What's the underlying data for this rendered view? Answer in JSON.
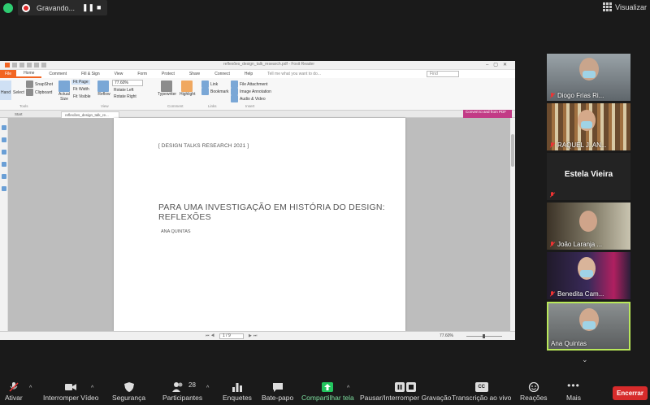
{
  "recording": {
    "label": "Gravando..."
  },
  "view": {
    "label": "Visualizar"
  },
  "reader": {
    "window_title": "reflexões_design_talk_research.pdf - Foxit Reader",
    "menu": [
      "File",
      "Home",
      "Comment",
      "Fill & Sign",
      "View",
      "Form",
      "Protect",
      "Share",
      "Connect",
      "Help"
    ],
    "tell_me": "Tell me what you want to do...",
    "find_placeholder": "Find",
    "ribbon": {
      "hand": "Hand",
      "select": "Select",
      "tools_group": "Tools",
      "snapshot": "SnapShot",
      "clipboard": "Clipboard",
      "actual_size": "Actual Size",
      "fit_page": "Fit Page",
      "fit_width": "Fit Width",
      "fit_visible": "Fit Visible",
      "reflow": "Reflow",
      "view_group": "View",
      "zoom": "77.60%",
      "rotate_left": "Rotate Left",
      "rotate_right": "Rotate Right",
      "typewriter": "Typewriter",
      "highlight": "Highlight",
      "comment_group": "Comment",
      "link": "Link",
      "bookmark": "Bookmark",
      "links_group": "Links",
      "file_attachment": "File Attachment",
      "image_annotation": "Image Annotation",
      "audio_video": "Audio & Video",
      "insert_group": "Insert",
      "promo": "Convert to and from PDF"
    },
    "tabs": {
      "start": "Start",
      "doc": "reflexões_design_talk_re..."
    },
    "document": {
      "tag": "[ DESIGN TALKS RESEARCH 2021 ]",
      "title_line1": "PARA UMA INVESTIGAÇÃO EM HISTÓRIA DO DESIGN:",
      "title_line2": "REFLEXÕES",
      "author": "ANA QUINTAS"
    },
    "status": {
      "page": "1 / 9",
      "zoom": "77.60%"
    }
  },
  "participants": [
    {
      "name": "Diogo Frias Ri...",
      "muted": true
    },
    {
      "name": "RAQUEL J. AN...",
      "muted": true
    },
    {
      "name": "Estela Vieira",
      "muted": true,
      "no_video": true
    },
    {
      "name": "João Laranja ...",
      "muted": true
    },
    {
      "name": "Benedita Cam...",
      "muted": true
    },
    {
      "name": "Ana Quintas",
      "muted": false,
      "active": true
    }
  ],
  "toolbar": {
    "mute": "Ativar",
    "video": "Interromper Vídeo",
    "security": "Segurança",
    "participants": "Participantes",
    "participants_count": "28",
    "polls": "Enquetes",
    "chat": "Bate-papo",
    "share": "Compartilhar tela",
    "record": "Pausar/Interromper Gravação",
    "cc_icon": "CC",
    "transcript": "Transcrição ao vivo",
    "reactions": "Reações",
    "more": "Mais",
    "end": "Encerrar"
  },
  "colors": {
    "share_green": "#22c55e",
    "end_red": "#d72b2b",
    "active_border": "#b9e85a",
    "foxit_orange": "#f26522"
  }
}
